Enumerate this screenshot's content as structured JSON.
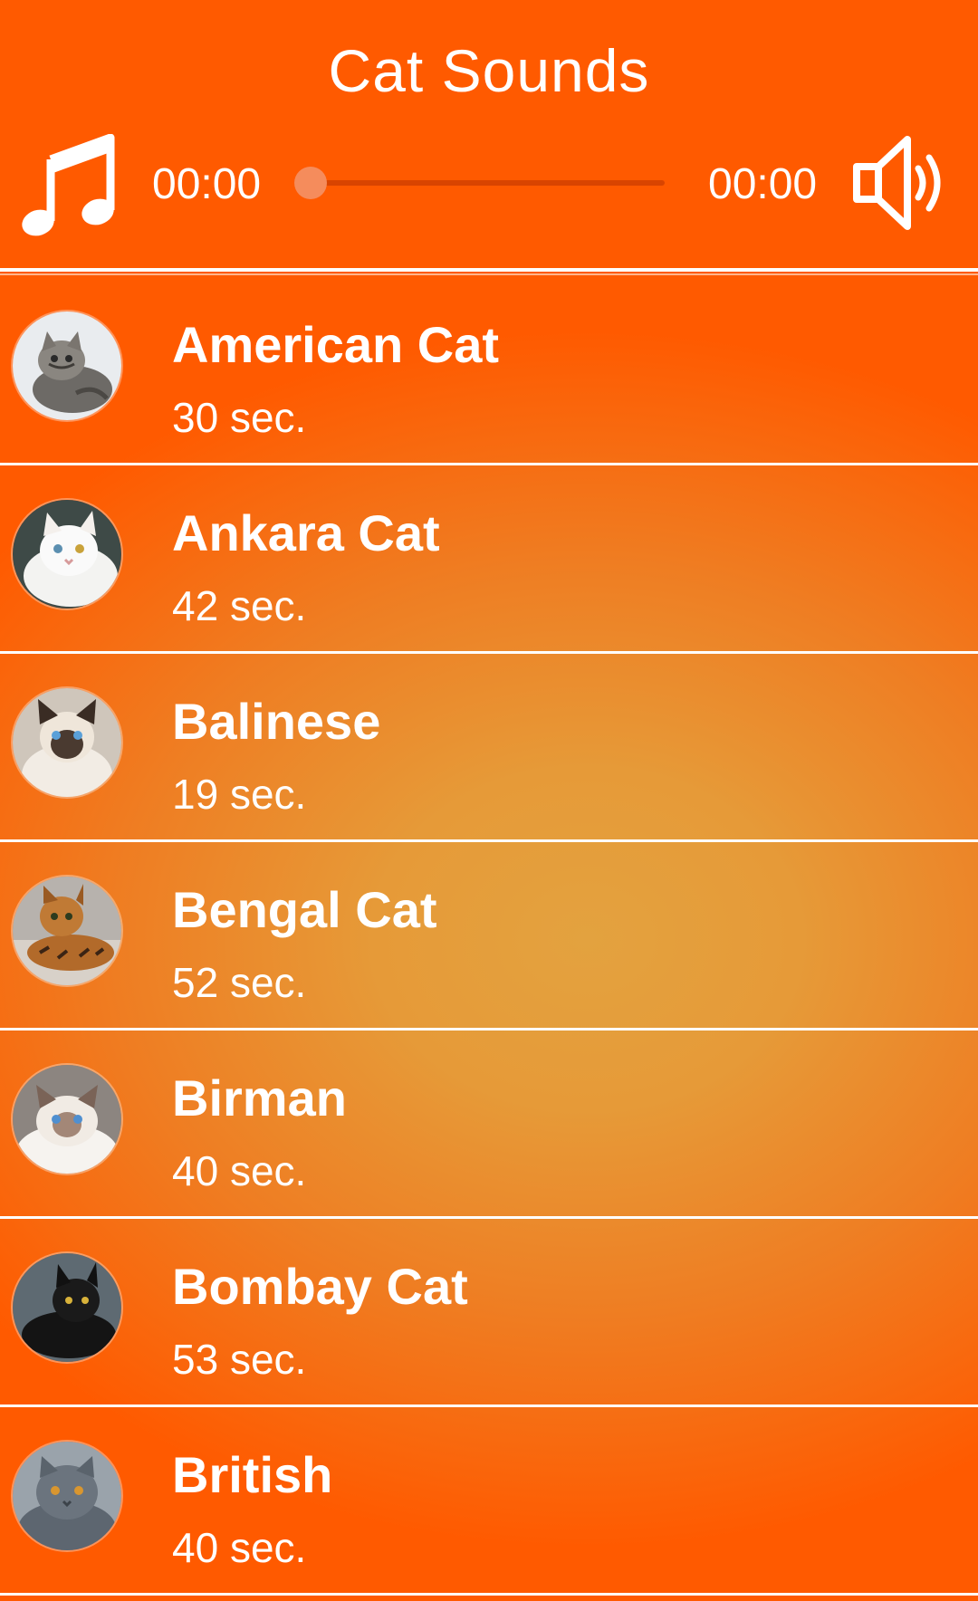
{
  "header": {
    "title": "Cat Sounds",
    "music_icon": "music-note-icon",
    "volume_icon": "speaker-volume-icon"
  },
  "player": {
    "current_time": "00:00",
    "total_time": "00:00",
    "progress": 0
  },
  "colors": {
    "header_background": "#ff5a00",
    "list_center": "#e3a23f",
    "list_edge": "#ff5a00",
    "separator": "#ffffff",
    "text": "#ffffff"
  },
  "sounds": [
    {
      "name": "American Cat",
      "duration": "30 sec."
    },
    {
      "name": "Ankara Cat",
      "duration": "42 sec."
    },
    {
      "name": "Balinese",
      "duration": "19 sec."
    },
    {
      "name": "Bengal Cat",
      "duration": "52 sec."
    },
    {
      "name": "Birman",
      "duration": "40 sec."
    },
    {
      "name": "Bombay Cat",
      "duration": "53 sec."
    },
    {
      "name": "British",
      "duration": "40 sec."
    }
  ]
}
